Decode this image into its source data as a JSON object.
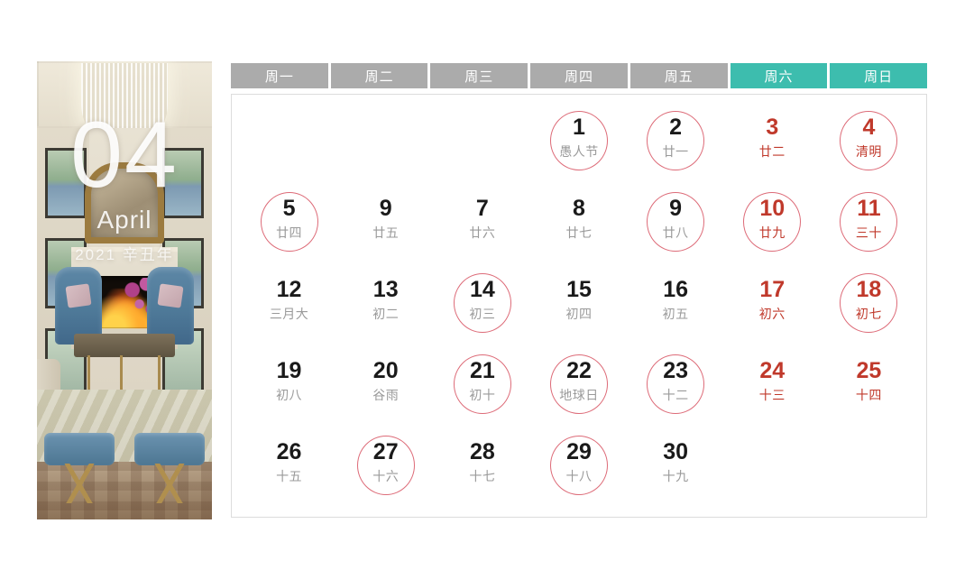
{
  "hero": {
    "month_number": "04",
    "month_name": "April",
    "year_line": "2021 辛丑年",
    "photo_alt": "luxury-living-room-interior"
  },
  "theme": {
    "weekday_bg": "#ABABAB",
    "weekend_bg": "#3DBDAE",
    "ring_color": "#DD6B78",
    "rest_text": "#C0392B",
    "lunar_text": "#9A9A9A",
    "card_border": "#DCDCDC"
  },
  "weekdays": [
    {
      "label": "周一",
      "weekend": false
    },
    {
      "label": "周二",
      "weekend": false
    },
    {
      "label": "周三",
      "weekend": false
    },
    {
      "label": "周四",
      "weekend": false
    },
    {
      "label": "周五",
      "weekend": false
    },
    {
      "label": "周六",
      "weekend": true
    },
    {
      "label": "周日",
      "weekend": true
    }
  ],
  "weeks": [
    [
      {
        "empty": true
      },
      {
        "empty": true
      },
      {
        "empty": true
      },
      {
        "num": "1",
        "lunar": "愚人节",
        "ring": true,
        "rest": false
      },
      {
        "num": "2",
        "lunar": "廿一",
        "ring": true,
        "rest": false
      },
      {
        "num": "3",
        "lunar": "廿二",
        "ring": false,
        "rest": true
      },
      {
        "num": "4",
        "lunar": "清明",
        "ring": true,
        "rest": true
      }
    ],
    [
      {
        "num": "5",
        "lunar": "廿四",
        "ring": true,
        "rest": false
      },
      {
        "num": "9",
        "lunar": "廿五",
        "ring": false,
        "rest": false
      },
      {
        "num": "7",
        "lunar": "廿六",
        "ring": false,
        "rest": false
      },
      {
        "num": "8",
        "lunar": "廿七",
        "ring": false,
        "rest": false
      },
      {
        "num": "9",
        "lunar": "廿八",
        "ring": true,
        "rest": false
      },
      {
        "num": "10",
        "lunar": "廿九",
        "ring": true,
        "rest": true
      },
      {
        "num": "11",
        "lunar": "三十",
        "ring": true,
        "rest": true
      }
    ],
    [
      {
        "num": "12",
        "lunar": "三月大",
        "ring": false,
        "rest": false
      },
      {
        "num": "13",
        "lunar": "初二",
        "ring": false,
        "rest": false
      },
      {
        "num": "14",
        "lunar": "初三",
        "ring": true,
        "rest": false
      },
      {
        "num": "15",
        "lunar": "初四",
        "ring": false,
        "rest": false
      },
      {
        "num": "16",
        "lunar": "初五",
        "ring": false,
        "rest": false
      },
      {
        "num": "17",
        "lunar": "初六",
        "ring": false,
        "rest": true
      },
      {
        "num": "18",
        "lunar": "初七",
        "ring": true,
        "rest": true
      }
    ],
    [
      {
        "num": "19",
        "lunar": "初八",
        "ring": false,
        "rest": false
      },
      {
        "num": "20",
        "lunar": "谷雨",
        "ring": false,
        "rest": false
      },
      {
        "num": "21",
        "lunar": "初十",
        "ring": true,
        "rest": false
      },
      {
        "num": "22",
        "lunar": "地球日",
        "ring": true,
        "rest": false
      },
      {
        "num": "23",
        "lunar": "十二",
        "ring": true,
        "rest": false
      },
      {
        "num": "24",
        "lunar": "十三",
        "ring": false,
        "rest": true
      },
      {
        "num": "25",
        "lunar": "十四",
        "ring": false,
        "rest": true
      }
    ],
    [
      {
        "num": "26",
        "lunar": "十五",
        "ring": false,
        "rest": false
      },
      {
        "num": "27",
        "lunar": "十六",
        "ring": true,
        "rest": false
      },
      {
        "num": "28",
        "lunar": "十七",
        "ring": false,
        "rest": false
      },
      {
        "num": "29",
        "lunar": "十八",
        "ring": true,
        "rest": false
      },
      {
        "num": "30",
        "lunar": "十九",
        "ring": false,
        "rest": false
      },
      {
        "empty": true
      },
      {
        "empty": true
      }
    ]
  ]
}
